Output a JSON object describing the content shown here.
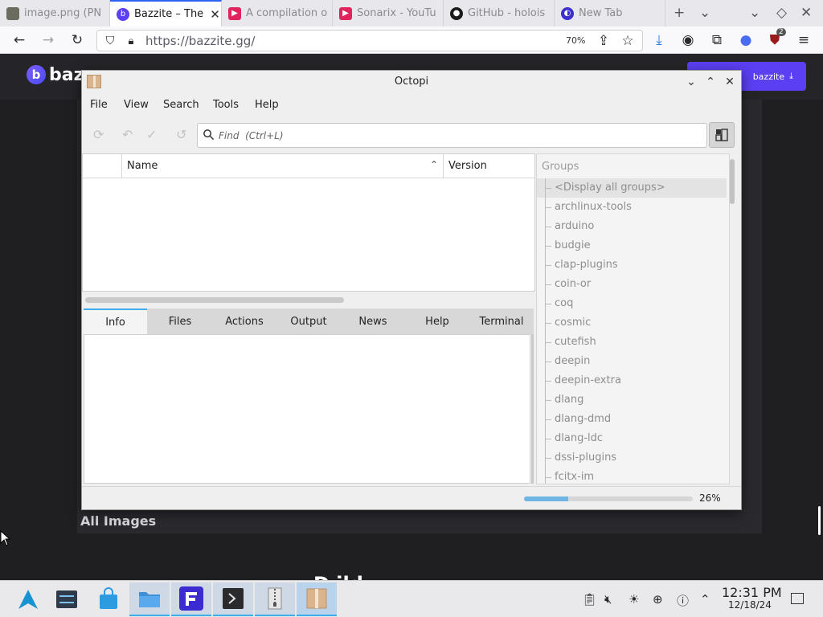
{
  "browser": {
    "tabs": [
      {
        "title": "image.png (PN",
        "active": false,
        "favicon": "image-file-icon"
      },
      {
        "title": "Bazzite – The",
        "active": true,
        "favicon": "bazzite-logo-icon"
      },
      {
        "title": "A compilation o",
        "active": false,
        "favicon": "youtube-icon"
      },
      {
        "title": "Sonarix - YouTu",
        "active": false,
        "favicon": "youtube-icon"
      },
      {
        "title": "GitHub - holois",
        "active": false,
        "favicon": "github-icon"
      },
      {
        "title": "New Tab",
        "active": false,
        "favicon": "firefox-icon"
      }
    ],
    "url": "https://bazzite.gg/",
    "zoom": "70%",
    "notification_badge": "2"
  },
  "website": {
    "logo_text": "baz",
    "download_label": "bazzite",
    "section_title": "All Images",
    "footer_partial": "D  ild"
  },
  "octopi": {
    "title": "Octopi",
    "menu": [
      "File",
      "View",
      "Search",
      "Tools",
      "Help"
    ],
    "find_placeholder": "Find  (Ctrl+L)",
    "columns": {
      "name": "Name",
      "version": "Version"
    },
    "detail_tabs": [
      "Info",
      "Files",
      "Actions",
      "Output",
      "News",
      "Help",
      "Terminal"
    ],
    "active_tab": "Info",
    "groups_header": "Groups",
    "groups": [
      "<Display all groups>",
      "archlinux-tools",
      "arduino",
      "budgie",
      "clap-plugins",
      "coin-or",
      "coq",
      "cosmic",
      "cutefish",
      "deepin",
      "deepin-extra",
      "dlang",
      "dlang-dmd",
      "dlang-ldc",
      "dssi-plugins",
      "fcitx-im"
    ],
    "progress_value": 0.26,
    "progress_text": "26%"
  },
  "taskbar": {
    "time": "12:31 PM",
    "date": "12/18/24"
  },
  "colors": {
    "accent": "#3daee9",
    "firefox_active_tab": "#2b63f0",
    "bazzite_purple": "#5b3ff2"
  }
}
